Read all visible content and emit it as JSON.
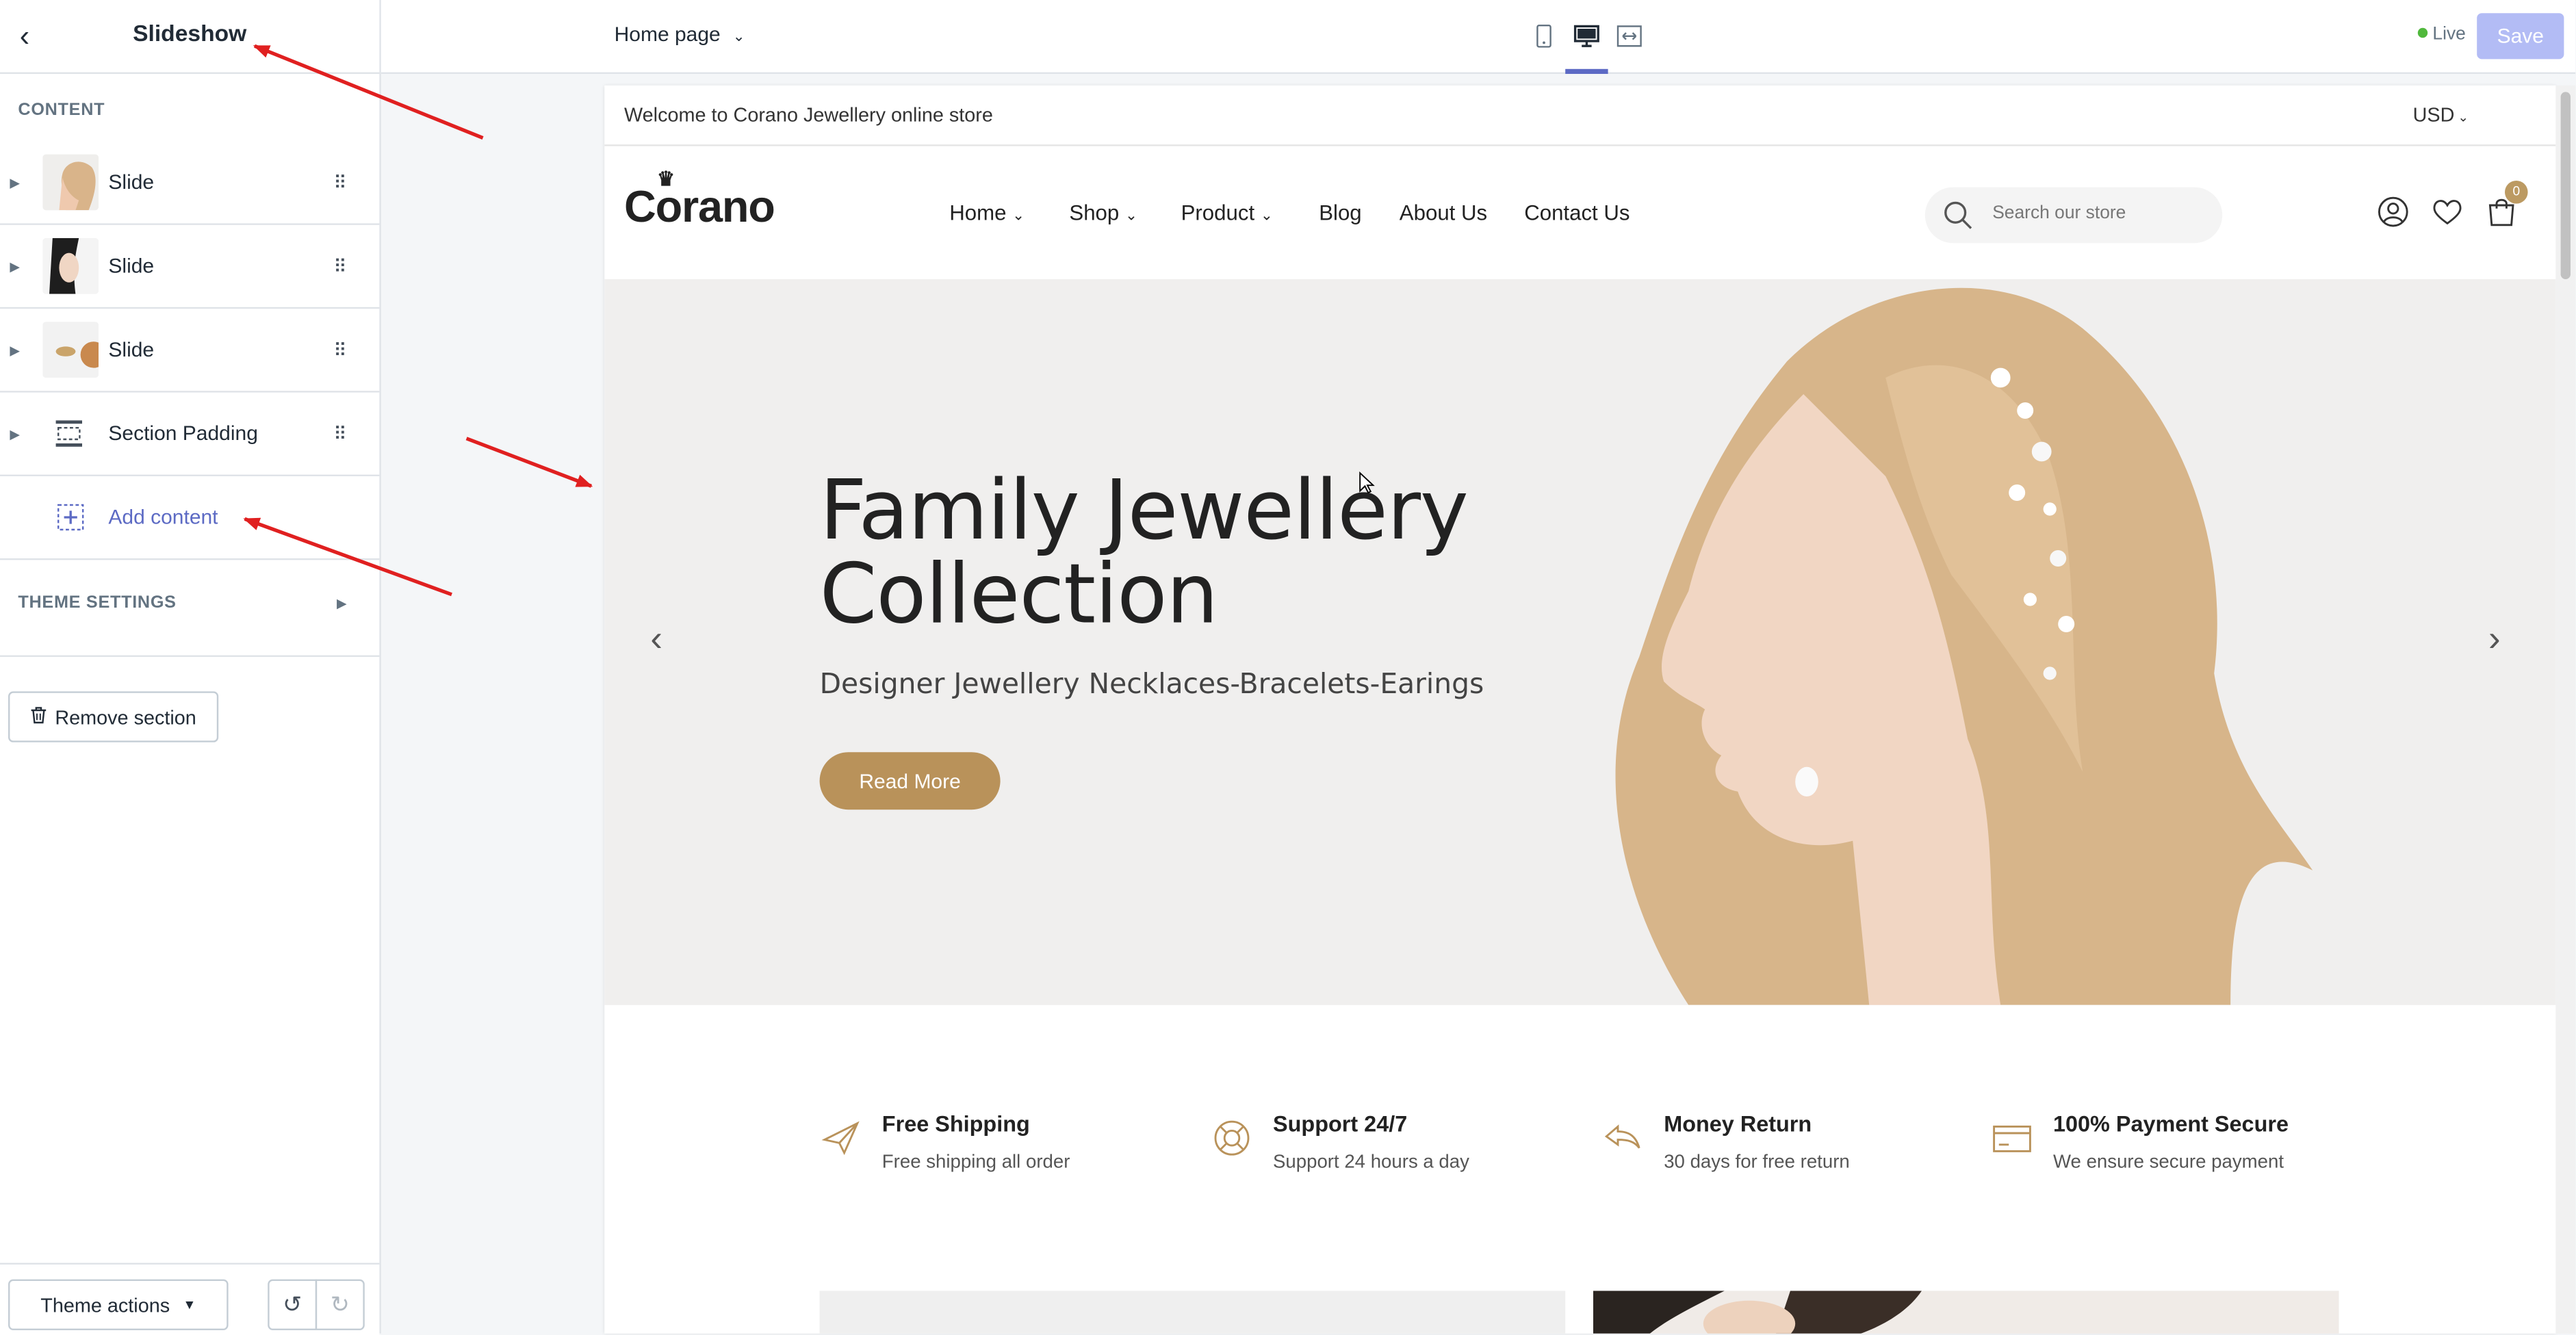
{
  "sidebar": {
    "title": "Slideshow",
    "content_label": "CONTENT",
    "items": [
      {
        "label": "Slide"
      },
      {
        "label": "Slide"
      },
      {
        "label": "Slide"
      },
      {
        "label": "Section Padding"
      }
    ],
    "add_content": "Add content",
    "theme_settings": "THEME SETTINGS",
    "remove_section": "Remove section",
    "theme_actions": "Theme actions"
  },
  "topbar": {
    "page": "Home page",
    "status": "Live",
    "save": "Save"
  },
  "store": {
    "announcement": "Welcome to Corano Jewellery online store",
    "currency": "USD",
    "logo": "Corano",
    "nav": [
      "Home",
      "Shop",
      "Product",
      "Blog",
      "About Us",
      "Contact Us"
    ],
    "search_placeholder": "Search our store",
    "cart_count": "0",
    "hero": {
      "title_line1": "Family Jewellery",
      "title_line2": "Collection",
      "subtitle": "Designer Jewellery Necklaces-Bracelets-Earings",
      "button": "Read More"
    },
    "features": [
      {
        "title": "Free Shipping",
        "subtitle": "Free shipping all order",
        "icon": "plane-icon"
      },
      {
        "title": "Support 24/7",
        "subtitle": "Support 24 hours a day",
        "icon": "lifebuoy-icon"
      },
      {
        "title": "Money Return",
        "subtitle": "30 days for free return",
        "icon": "return-icon"
      },
      {
        "title": "100% Payment Secure",
        "subtitle": "We ensure secure payment",
        "icon": "card-icon"
      }
    ]
  },
  "colors": {
    "accent": "#5c6ac4",
    "gold": "#b9925a",
    "annotation_arrow": "#e02020"
  }
}
